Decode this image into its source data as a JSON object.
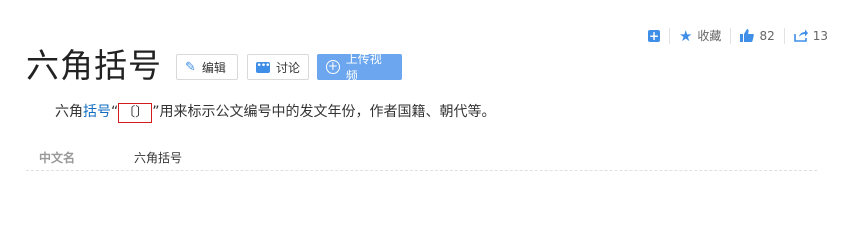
{
  "toolbar": {
    "collect_label": "收藏",
    "like_count": "82",
    "share_count": "13"
  },
  "entry": {
    "title": "六角括号",
    "edit_label": "编辑",
    "discuss_label": "讨论",
    "upload_video_label": "上传视频"
  },
  "summary": {
    "prefix": "六角",
    "link": "括号",
    "quote_open": "“",
    "bracket": "〔〕",
    "rest": "”用来标示公文编号中的发文年份，作者国籍、朝代等。"
  },
  "basic_info": {
    "name": "中文名",
    "value": "六角括号"
  },
  "colors": {
    "accent": "#3f8ee8",
    "upload_button": "#6ba6ef",
    "link": "#136ec2",
    "highlight_box": "#d21d1d"
  },
  "icons": [
    "add-icon",
    "star-icon",
    "thumbs-up-icon",
    "share-icon",
    "pencil-icon",
    "chat-icon",
    "upload-icon"
  ]
}
